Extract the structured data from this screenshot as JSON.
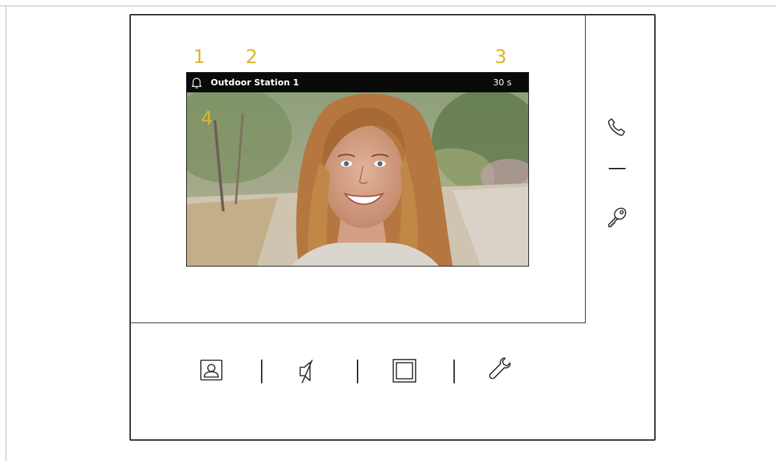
{
  "callouts": [
    "1",
    "2",
    "3",
    "4"
  ],
  "status_bar": {
    "station_name": "Outdoor Station 1",
    "timer": "30 s"
  },
  "icons": {
    "status": "bell-icon",
    "side": [
      "phone-icon",
      "minus-icon",
      "key-icon"
    ],
    "bottom": [
      "camera-view-icon",
      "mute-icon",
      "fullscreen-icon",
      "settings-wrench-icon"
    ]
  },
  "colors": {
    "callout": "#d9b431",
    "status_bar_bg": "#0a0a0a",
    "outline": "#2a2a2a"
  }
}
